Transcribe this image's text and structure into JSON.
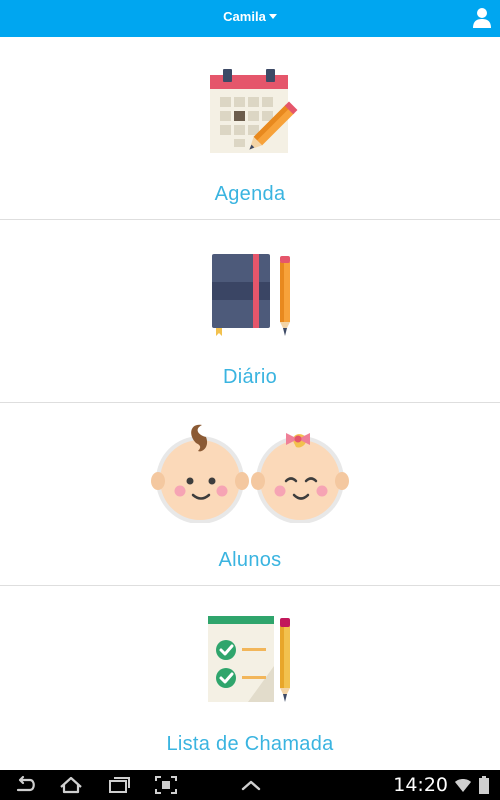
{
  "header": {
    "user_name": "Camila",
    "icons": [
      "chevron-down-icon",
      "user-profile-icon"
    ]
  },
  "menu": {
    "items": [
      {
        "label": "Agenda",
        "icon": "calendar-edit-icon"
      },
      {
        "label": "Diário",
        "icon": "notebook-pencil-icon"
      },
      {
        "label": "Alunos",
        "icon": "babies-icon"
      },
      {
        "label": "Lista de Chamada",
        "icon": "attendance-list-icon"
      }
    ]
  },
  "system_bar": {
    "time": "14:20",
    "icons": [
      "back-icon",
      "home-icon",
      "recent-apps-icon",
      "screenshot-icon",
      "chevron-up-icon",
      "wifi-icon",
      "battery-icon"
    ]
  },
  "colors": {
    "app_bar": "#00a6f0",
    "label": "#3ab4e0",
    "divider": "#dedede",
    "system_bar": "#000000"
  }
}
